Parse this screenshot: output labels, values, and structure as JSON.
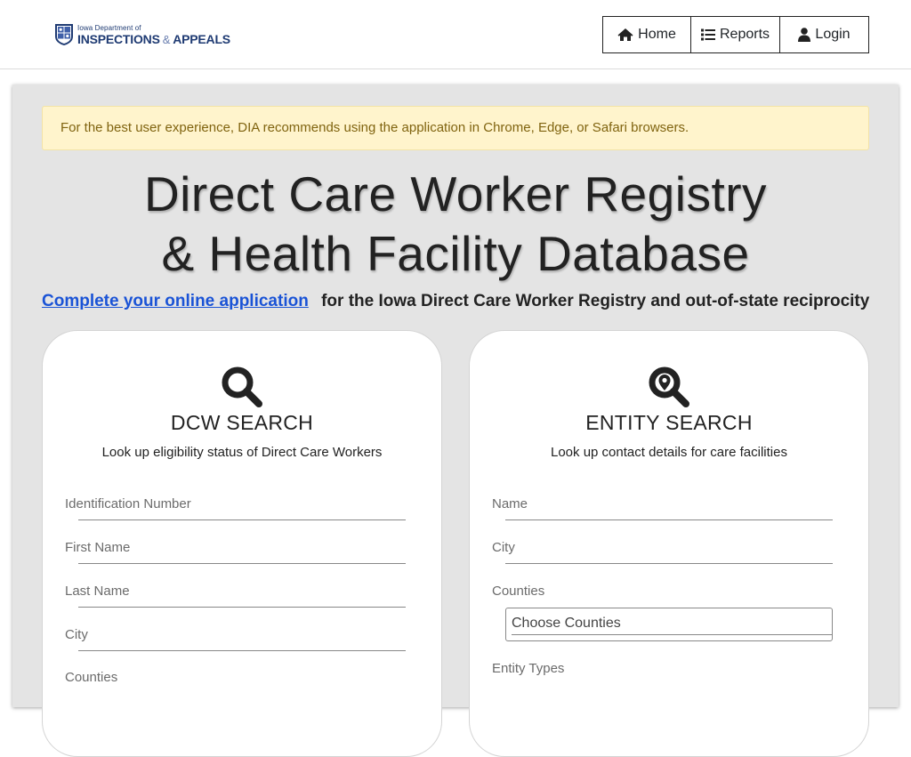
{
  "header": {
    "logo": {
      "small_text": "Iowa Department of",
      "main_left": "INSPECTIONS",
      "amp": "&",
      "main_right": "APPEALS"
    },
    "nav": [
      {
        "label": "Home",
        "icon": "home-icon"
      },
      {
        "label": "Reports",
        "icon": "list-icon"
      },
      {
        "label": "Login",
        "icon": "user-icon"
      }
    ]
  },
  "alert": {
    "text": "For the best user experience, DIA recommends using the application in Chrome, Edge, or Safari browsers."
  },
  "title": {
    "line1": "Direct Care Worker Registry",
    "line2": "& Health Facility Database"
  },
  "application": {
    "link_text": "Complete your online application",
    "rest_text": "for the Iowa Direct Care Worker Registry and out-of-state reciprocity"
  },
  "dcw_search": {
    "icon": "search-icon",
    "title": "DCW SEARCH",
    "subtitle": "Look up eligibility status of Direct Care Workers",
    "fields": [
      {
        "label": "Identification Number",
        "value": ""
      },
      {
        "label": "First Name",
        "value": ""
      },
      {
        "label": "Last Name",
        "value": ""
      },
      {
        "label": "City",
        "value": ""
      },
      {
        "label": "Counties",
        "value": ""
      }
    ]
  },
  "entity_search": {
    "icon": "map-marker-search-icon",
    "title": "ENTITY SEARCH",
    "subtitle": "Look up contact details for care facilities",
    "fields": [
      {
        "label": "Name",
        "value": ""
      },
      {
        "label": "City",
        "value": ""
      },
      {
        "label": "Counties",
        "placeholder": "Choose Counties"
      },
      {
        "label": "Entity Types",
        "value": ""
      }
    ]
  },
  "colors": {
    "link": "#1a53d6",
    "alert_bg": "#fff4cc",
    "alert_text": "#806410",
    "panel_bg": "#e4e4e4",
    "logo_blue": "#1f3b73"
  }
}
